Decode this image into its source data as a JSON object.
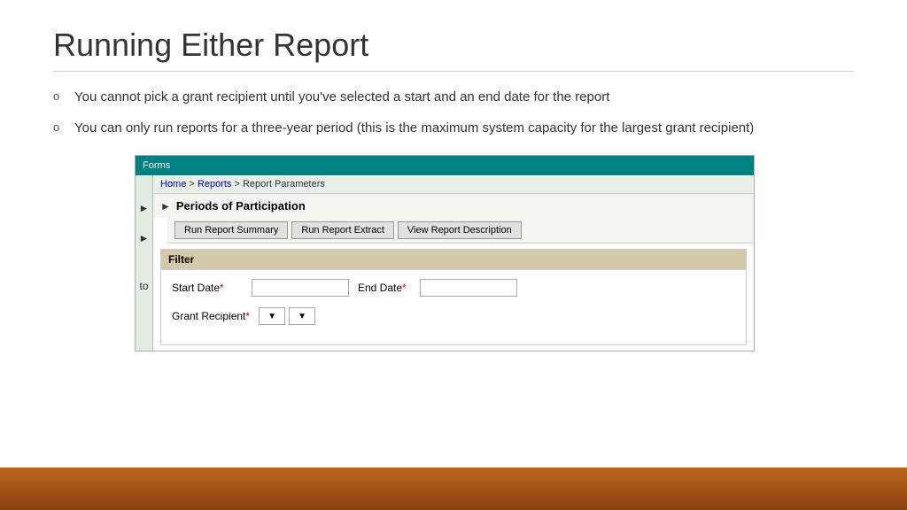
{
  "slide": {
    "title": "Running Either Report",
    "bullets": [
      {
        "text": "You cannot pick a grant recipient until you've selected a start and an end date for the report"
      },
      {
        "text": "You can only run reports for a three-year period (this is the maximum system capacity for the largest grant recipient)"
      }
    ]
  },
  "ui": {
    "topbar_text": "Forms",
    "breadcrumb": {
      "home": "Home",
      "separator1": " > ",
      "reports": "Reports",
      "separator2": " > ",
      "page": "Report Parameters"
    },
    "section_title": "Periods of Participation",
    "buttons": {
      "run_summary": "Run Report Summary",
      "run_extract": "Run Report Extract",
      "view_description": "View Report Description"
    },
    "filter_label": "Filter",
    "start_date_label": "Start Date",
    "end_date_label": "End Date",
    "grant_recipient_label": "Grant Recipient",
    "required_marker": "*"
  },
  "bottom_bar": {
    "color": "#c0651a"
  }
}
